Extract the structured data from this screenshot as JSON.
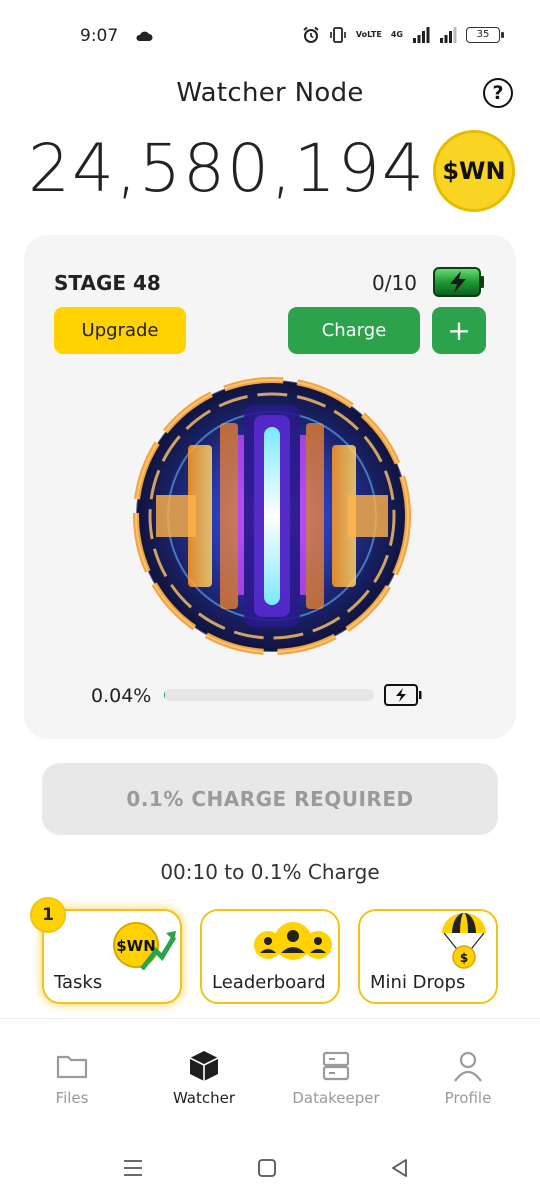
{
  "status_bar": {
    "time": "9:07",
    "net_label": "VoLTE",
    "net_type": "4G",
    "battery_level": "35"
  },
  "header": {
    "title": "Watcher Node",
    "help_symbol": "?"
  },
  "balance": {
    "amount": "24,580,194",
    "token_label": "$WN"
  },
  "card": {
    "stage": "STAGE 48",
    "charge_count": "0/10",
    "upgrade_label": "Upgrade",
    "charge_label": "Charge",
    "plus_label": "+",
    "progress_text": "0.04%",
    "progress_fraction": 0.0004
  },
  "charge_required": "0.1% CHARGE REQUIRED",
  "timer_text": "00:10 to 0.1% Charge",
  "tiles": {
    "tasks": {
      "label": "Tasks",
      "badge": "1",
      "coin_label": "$WN"
    },
    "leaderboard": {
      "label": "Leaderboard"
    },
    "mini_drops": {
      "label": "Mini Drops",
      "coin_symbol": "$"
    }
  },
  "nav": {
    "items": [
      {
        "label": "Files",
        "icon": "folder-icon"
      },
      {
        "label": "Watcher",
        "icon": "cube-icon",
        "active": true
      },
      {
        "label": "Datakeeper",
        "icon": "server-icon"
      },
      {
        "label": "Profile",
        "icon": "user-icon"
      }
    ]
  },
  "colors": {
    "accent_yellow": "#ffd200",
    "accent_green": "#2ca24a",
    "card_bg": "#f5f5f5"
  }
}
